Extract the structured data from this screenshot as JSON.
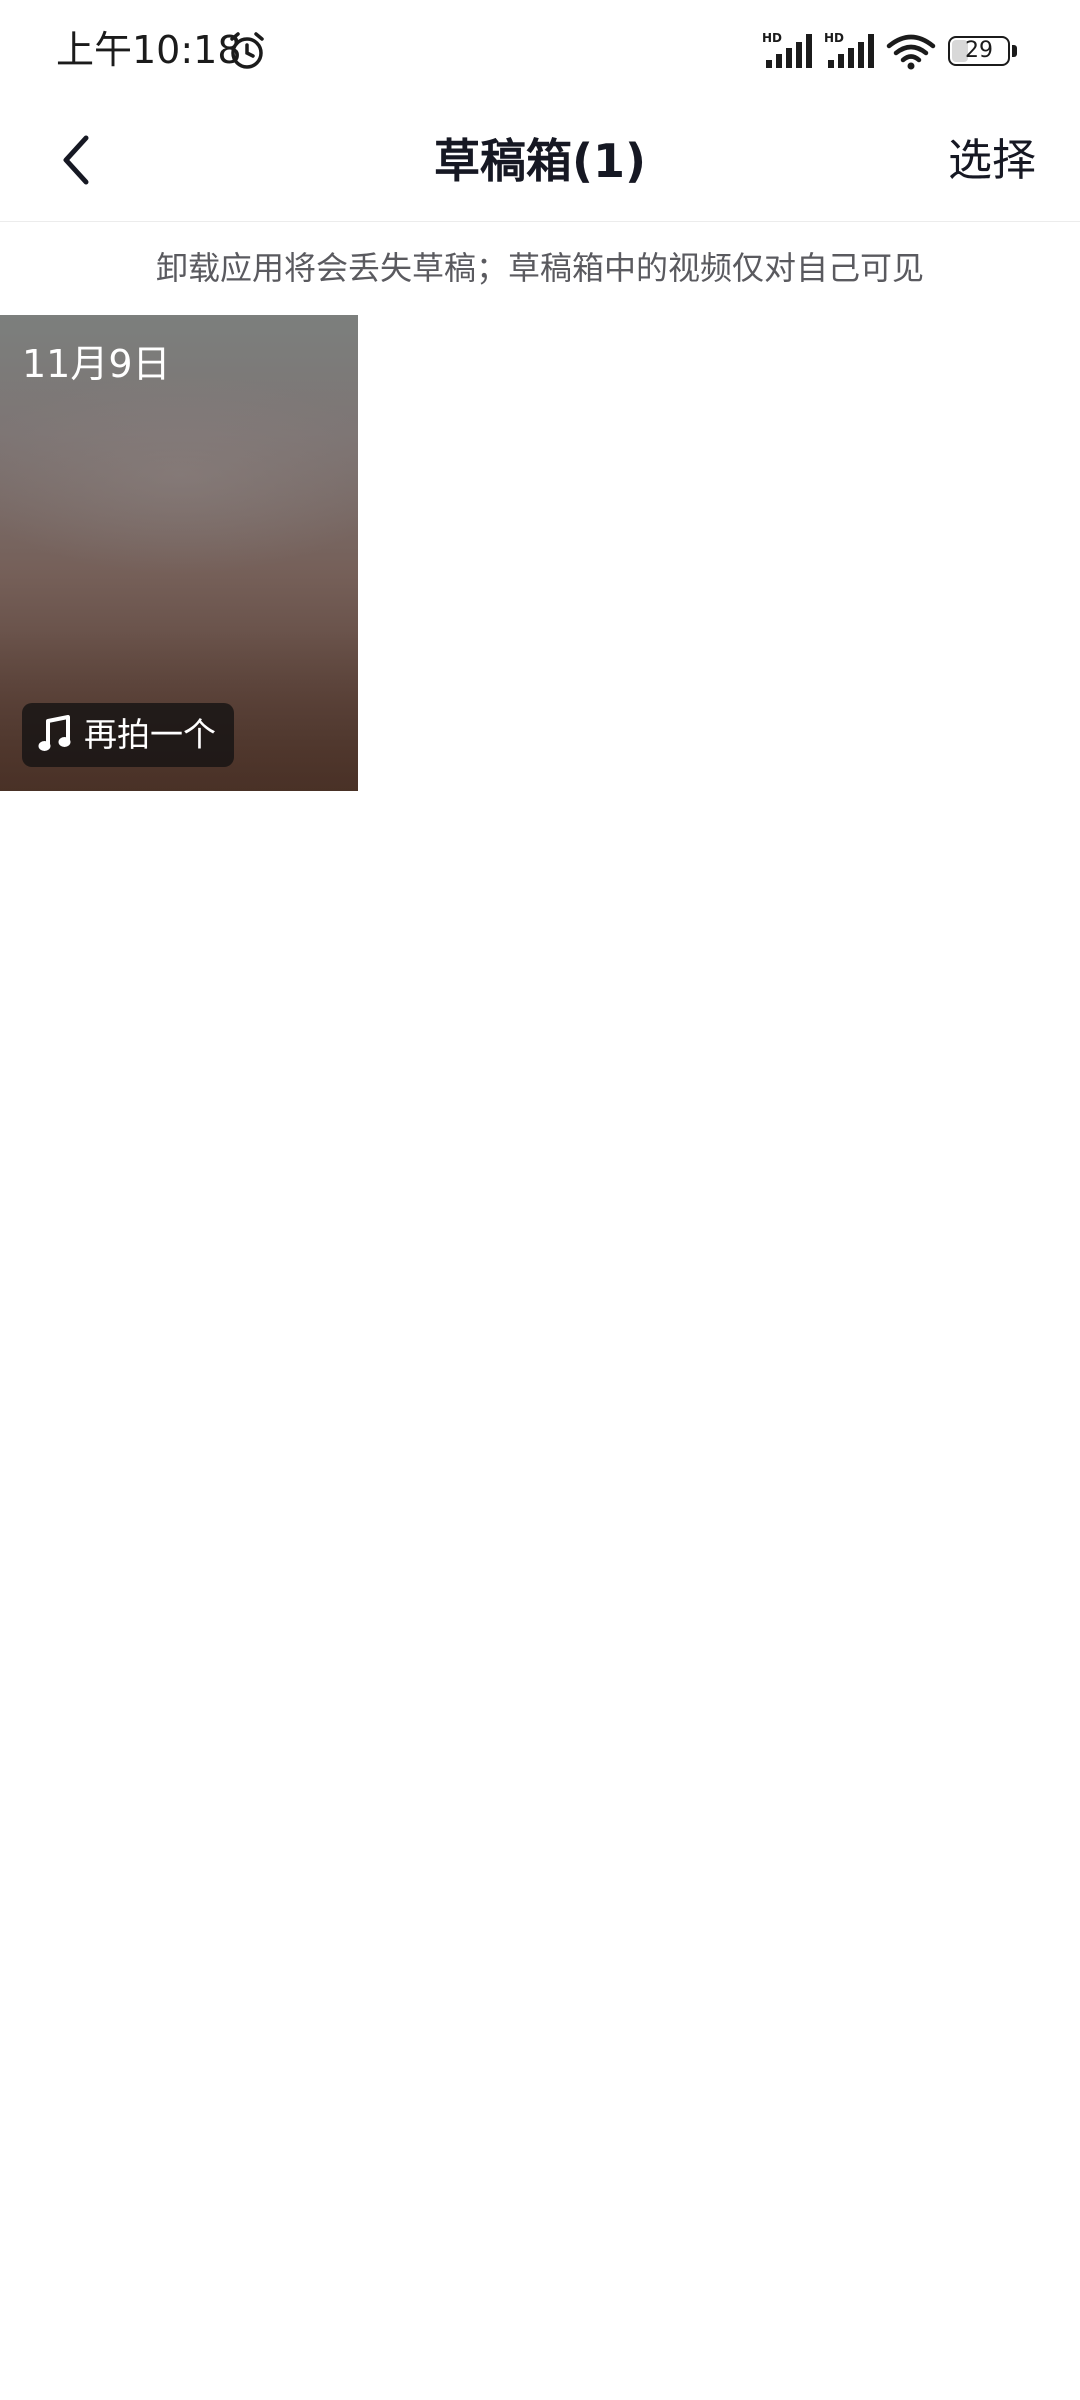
{
  "status_bar": {
    "time": "上午10:18",
    "battery": "29",
    "battery_level": 0.29,
    "icons": [
      "alarm-icon",
      "hd-signal-icon",
      "hd-signal-icon",
      "wifi-icon",
      "battery-icon"
    ]
  },
  "nav": {
    "back_icon": "chevron-left-icon",
    "title": "草稿箱(1)",
    "select_label": "选择"
  },
  "notice": {
    "text": "卸载应用将会丢失草稿；草稿箱中的视频仅对自己可见"
  },
  "drafts": [
    {
      "date": "11月9日",
      "action_icon": "music-note-icon",
      "action_label": "再拍一个"
    }
  ],
  "colors": {
    "text_primary": "#161823",
    "text_secondary": "#5a5a5f",
    "background": "#ffffff",
    "divider": "#ececec"
  }
}
